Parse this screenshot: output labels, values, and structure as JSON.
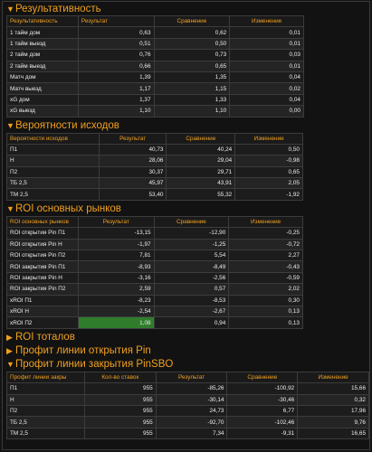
{
  "sections": {
    "results": {
      "title": "Результативность",
      "headers": [
        "Результативность",
        "Результат",
        "Сравнение",
        "Изменение"
      ],
      "rows": [
        [
          "1 тайм дом",
          "0,63",
          "0,62",
          "0,01"
        ],
        [
          "1 тайм выезд",
          "0,51",
          "0,50",
          "0,01"
        ],
        [
          "2 тайм дом",
          "0,76",
          "0,73",
          "0,03"
        ],
        [
          "2 тайм выезд",
          "0,66",
          "0,65",
          "0,01"
        ],
        [
          "Матч дом",
          "1,39",
          "1,35",
          "0,04"
        ],
        [
          "Матч выезд",
          "1,17",
          "1,15",
          "0,02"
        ],
        [
          "xG дом",
          "1,37",
          "1,33",
          "0,04"
        ],
        [
          "xG выезд",
          "1,10",
          "1,10",
          "0,00"
        ]
      ]
    },
    "probabilities": {
      "title": "Вероятности исходов",
      "headers": [
        "Вероятности исходов",
        "Результат",
        "Сравнение",
        "Изменение"
      ],
      "rows": [
        [
          "П1",
          "40,73",
          "40,24",
          "0,50"
        ],
        [
          "Н",
          "28,06",
          "29,04",
          "-0,98"
        ],
        [
          "П2",
          "30,37",
          "29,71",
          "0,65"
        ],
        [
          "ТБ 2,5",
          "45,97",
          "43,91",
          "2,05"
        ],
        [
          "ТМ 2,5",
          "53,40",
          "55,32",
          "-1,92"
        ]
      ]
    },
    "roi": {
      "title": "ROI основных рынков",
      "headers": [
        "ROI основных рынков",
        "Результат",
        "Сравнение",
        "Изменение"
      ],
      "rows": [
        [
          "ROI открытия Pin П1",
          "-13,15",
          "-12,90",
          "-0,25"
        ],
        [
          "ROI открытия Pin Н",
          "-1,97",
          "-1,25",
          "-0,72"
        ],
        [
          "ROI открытия Pin П2",
          "7,81",
          "5,54",
          "2,27"
        ],
        [
          "ROI закрытия Pin П1",
          "-8,93",
          "-8,49",
          "-0,43"
        ],
        [
          "ROI закрытия Pin Н",
          "-3,16",
          "-2,56",
          "-0,59"
        ],
        [
          "ROI закрытия Pin П2",
          "2,59",
          "0,57",
          "2,02"
        ],
        [
          "xROI П1",
          "-8,23",
          "-8,53",
          "0,30"
        ],
        [
          "xROI Н",
          "-2,54",
          "-2,67",
          "0,13"
        ],
        [
          "xROI П2",
          "1,08",
          "0,94",
          "0,13"
        ]
      ]
    },
    "roi_totals": {
      "title": "ROI тоталов"
    },
    "open_profit": {
      "title": "Профит линии открытия Pin"
    },
    "close_profit": {
      "title": "Профит линии закрытия PinSBO",
      "headers": [
        "Профит линии закры",
        "Кол-во ставок",
        "Результат",
        "Сравнение",
        "Изменение"
      ],
      "rows": [
        [
          "П1",
          "955",
          "-85,26",
          "-100,92",
          "15,66"
        ],
        [
          "Н",
          "955",
          "-30,14",
          "-30,46",
          "0,32"
        ],
        [
          "П2",
          "955",
          "24,73",
          "6,77",
          "17,96"
        ],
        [
          "ТБ 2,5",
          "955",
          "-92,70",
          "-102,46",
          "9,76"
        ],
        [
          "ТМ 2,5",
          "955",
          "7,34",
          "-9,31",
          "16,65"
        ]
      ]
    }
  },
  "colors": {
    "accent": "#f0a020",
    "highlight": "#2f7d2c",
    "background": "#121212"
  },
  "icons": {
    "expanded": "triangle-down-icon",
    "collapsed": "triangle-right-icon"
  }
}
